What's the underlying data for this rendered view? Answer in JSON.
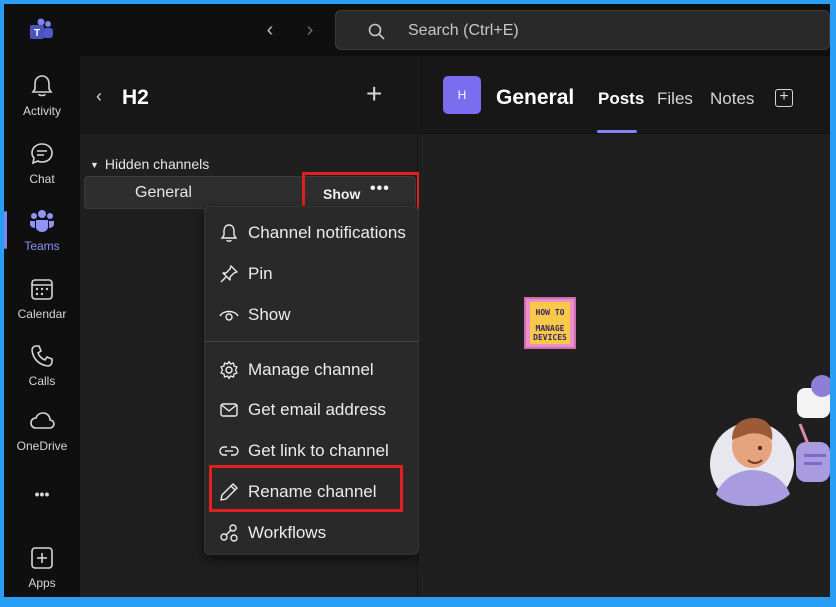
{
  "titlebar": {
    "search_placeholder": "Search (Ctrl+E)"
  },
  "rail": {
    "items": [
      {
        "label": "Activity"
      },
      {
        "label": "Chat"
      },
      {
        "label": "Teams"
      },
      {
        "label": "Calendar"
      },
      {
        "label": "Calls"
      },
      {
        "label": "OneDrive"
      },
      {
        "label": "Apps"
      }
    ],
    "more_label": "•••"
  },
  "list_pane": {
    "team_name": "H2",
    "section_label": "Hidden channels",
    "channel": {
      "name": "General",
      "show_label": "Show",
      "more_label": "•••"
    }
  },
  "menu": {
    "items": [
      {
        "label": "Channel notifications",
        "icon": "bell-icon"
      },
      {
        "label": "Pin",
        "icon": "pin-icon"
      },
      {
        "label": "Show",
        "icon": "eye-icon"
      },
      {
        "label": "Manage channel",
        "icon": "gear-icon"
      },
      {
        "label": "Get email address",
        "icon": "mail-icon"
      },
      {
        "label": "Get link to channel",
        "icon": "link-icon"
      },
      {
        "label": "Rename channel",
        "icon": "pencil-icon"
      },
      {
        "label": "Workflows",
        "icon": "workflow-icon"
      }
    ]
  },
  "main": {
    "avatar_letter": "H",
    "channel_title": "General",
    "tabs": [
      {
        "label": "Posts"
      },
      {
        "label": "Files"
      },
      {
        "label": "Notes"
      }
    ],
    "add_tab": "+"
  },
  "watermark": {
    "line1": "HOW TO",
    "line2": "MANAGE",
    "line3": "DEVICES"
  },
  "colors": {
    "accent": "#7f85f5",
    "highlight": "#e0201f",
    "border": "#2a9df4"
  }
}
